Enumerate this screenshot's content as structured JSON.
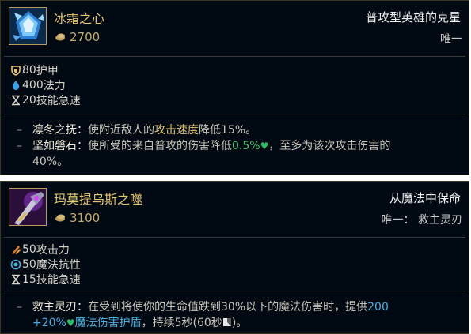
{
  "items": [
    {
      "name": "冰霜之心",
      "cost": "2700",
      "tagline": "普攻型英雄的克星",
      "unique": "唯一",
      "stats": [
        {
          "icon": "armor-icon",
          "value": "80",
          "label": "护甲"
        },
        {
          "icon": "magic-resist-drop-icon",
          "value": "400",
          "label": "法力"
        },
        {
          "icon": "ability-haste-icon",
          "value": "20",
          "label": "技能急速"
        }
      ],
      "effects": [
        {
          "name": "凛冬之抚：",
          "pre": "使附近敌人的",
          "highlight": "攻击速度",
          "post": "降低15%。"
        },
        {
          "name": "坚如磐石：",
          "pre": "使所受的来自普攻的伤害降低",
          "green": "0.5%",
          "post2": "，至多为该次攻击伤害的",
          "post3": "40%。"
        }
      ]
    },
    {
      "name": "玛莫提乌斯之噬",
      "cost": "3100",
      "tagline": "从魔法中保命",
      "unique": "唯一： 救主灵刃",
      "stats": [
        {
          "icon": "attack-damage-icon",
          "value": "50",
          "label": "攻击力"
        },
        {
          "icon": "magic-resist-icon",
          "value": "50",
          "label": "魔法抗性"
        },
        {
          "icon": "ability-haste-icon",
          "value": "15",
          "label": "技能急速"
        }
      ],
      "effects": [
        {
          "name": "救主灵刃：",
          "pre": "在受到将使你的生命值跌到30%以下的魔法伤害时，提供",
          "blue1": "200",
          "blue2": "+20%",
          "shield": "魔法伤害护盾",
          "post": "，持续5秒(60秒",
          "post_end": ")。"
        }
      ]
    }
  ],
  "colors": {
    "background": "#010a13",
    "gold": "#e6c66e",
    "green": "#48c46e",
    "blue": "#48b0e0"
  }
}
